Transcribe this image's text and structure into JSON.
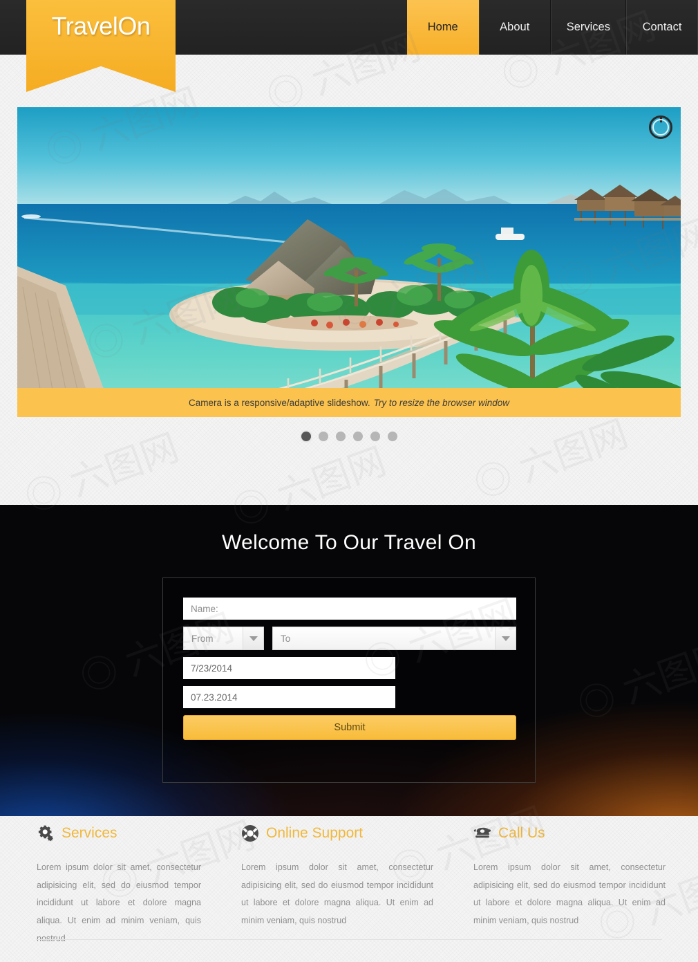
{
  "site": {
    "logo_text": "TravelOn",
    "accent_color": "#f7b02a",
    "header_bg": "#262626"
  },
  "nav": {
    "items": [
      {
        "label": "Home",
        "active": true
      },
      {
        "label": "About",
        "active": false
      },
      {
        "label": "Services",
        "active": false
      },
      {
        "label": "Contact",
        "active": false
      }
    ]
  },
  "slider": {
    "caption_main": "Camera is a responsive/adaptive slideshow.",
    "caption_em": "Try to resize the browser window",
    "loader_icon": "circular-progress-icon",
    "dot_count": 6,
    "active_dot": 1,
    "slide_alt": "Tropical island resort with boardwalk, thatched bungalows and palm trees"
  },
  "welcome": {
    "title": "Welcome To Our Travel On"
  },
  "form": {
    "name_placeholder": "Name:",
    "name_value": "",
    "from_label": "From",
    "to_label": "To",
    "date_one": "7/23/2014",
    "date_two": "07.23.2014",
    "submit_label": "Submit",
    "dropdown_icon": "chevron-down-icon"
  },
  "columns": [
    {
      "icon": "gears-icon",
      "title": "Services",
      "body": "Lorem ipsum dolor sit amet, consectetur adipisicing elit, sed do eiusmod tempor incididunt ut labore et dolore magna aliqua. Ut enim ad minim veniam, quis nostrud"
    },
    {
      "icon": "lifebuoy-icon",
      "title": "Online Support",
      "body": "Lorem ipsum dolor sit amet, consectetur adipisicing elit, sed do eiusmod tempor incididunt ut labore et dolore magna aliqua. Ut enim ad minim veniam, quis nostrud"
    },
    {
      "icon": "telephone-icon",
      "title": "Call Us",
      "body": "Lorem ipsum dolor sit amet, consectetur adipisicing elit, sed do eiusmod tempor incididunt ut labore et dolore magna aliqua. Ut enim ad minim veniam, quis nostrud"
    }
  ]
}
